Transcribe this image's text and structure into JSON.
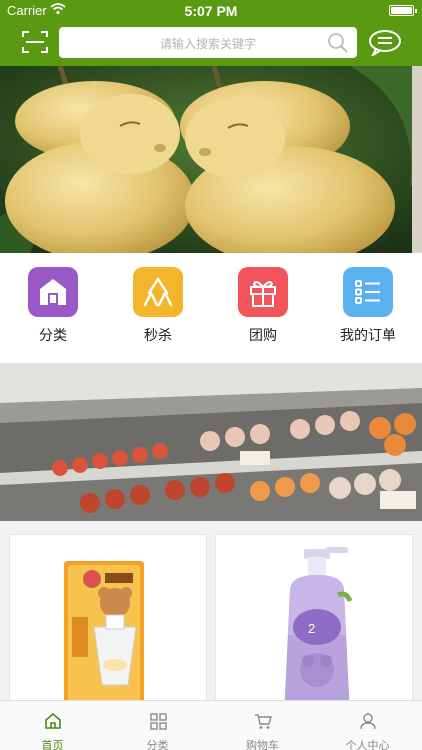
{
  "status_bar": {
    "carrier": "Carrier",
    "time": "5:07 PM"
  },
  "header": {
    "search_placeholder": "请输入搜索关键字"
  },
  "quick_nav": [
    {
      "label": "分类",
      "icon": "house-icon",
      "color": "#9b59c8"
    },
    {
      "label": "秒杀",
      "icon": "crowd-icon",
      "color": "#f3b52b"
    },
    {
      "label": "团购",
      "icon": "gift-icon",
      "color": "#f2545b"
    },
    {
      "label": "我的订单",
      "icon": "list-icon",
      "color": "#5bb0f0"
    }
  ],
  "tab_bar": [
    {
      "label": "首页",
      "icon": "home-icon",
      "active": true
    },
    {
      "label": "分类",
      "icon": "grid-icon",
      "active": false
    },
    {
      "label": "购物车",
      "icon": "cart-icon",
      "active": false
    },
    {
      "label": "个人中心",
      "icon": "user-icon",
      "active": false
    }
  ],
  "colors": {
    "brand_green": "#5a9a12",
    "active_tab": "#4a8a10"
  }
}
